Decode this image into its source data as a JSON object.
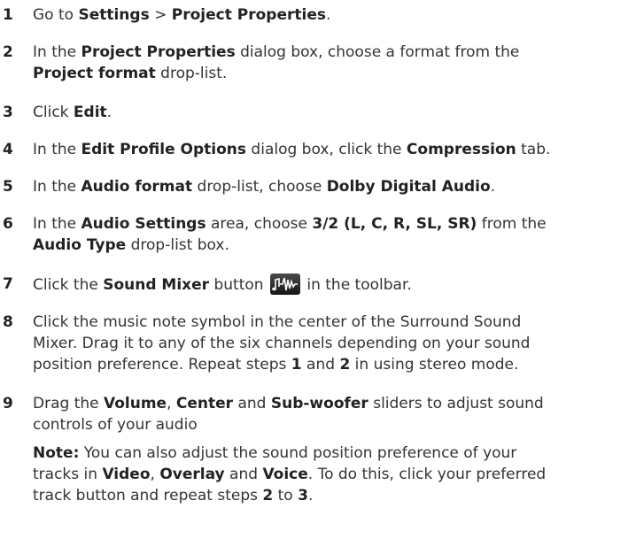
{
  "steps": [
    {
      "num": "1",
      "p": [
        "Go to ",
        "Settings",
        " > ",
        "Project Properties",
        "."
      ]
    },
    {
      "num": "2",
      "p": [
        "In the ",
        "Project Properties",
        " dialog box, choose a format from the",
        "Project format",
        " drop-list."
      ]
    },
    {
      "num": "3",
      "p": [
        "Click ",
        "Edit",
        "."
      ]
    },
    {
      "num": "4",
      "p": [
        "In the ",
        "Edit Profile Options",
        " dialog box, click the ",
        "Compression",
        " tab."
      ]
    },
    {
      "num": "5",
      "p": [
        "In the ",
        "Audio format",
        " drop-list, choose ",
        "Dolby Digital Audio",
        "."
      ]
    },
    {
      "num": "6",
      "p": [
        "In the ",
        "Audio Settings",
        " area, choose ",
        "3/2 (L, C, R, SL, SR)",
        " from the",
        "Audio Type",
        " drop-list box."
      ]
    },
    {
      "num": "7",
      "p": [
        "Click the ",
        "Sound Mixer",
        " button",
        " in the toolbar."
      ]
    },
    {
      "num": "8",
      "p": [
        "Click the music note symbol in the center of the Surround Sound",
        "Mixer. Drag it to any of the six channels depending on your sound",
        "position preference. Repeat steps ",
        "1",
        " and ",
        "2",
        " in using stereo mode."
      ]
    },
    {
      "num": "9",
      "p": [
        "Drag the ",
        "Volume",
        ", ",
        "Center",
        " and ",
        "Sub-woofer",
        " sliders to adjust sound",
        "controls of your audio"
      ]
    }
  ],
  "note": {
    "label": "Note:",
    "p": [
      " You can also adjust the sound position preference of your",
      "tracks in ",
      "Video",
      ", ",
      "Overlay",
      " and ",
      "Voice",
      ". To do this, click your preferred",
      "track button and repeat steps ",
      "2",
      " to ",
      "3",
      "."
    ]
  },
  "icons": {
    "sound_mixer": "sound-mixer-icon"
  },
  "colors": {
    "text": "#333333",
    "icon_bg": "#2a2a2a",
    "icon_fg": "#ffffff"
  }
}
